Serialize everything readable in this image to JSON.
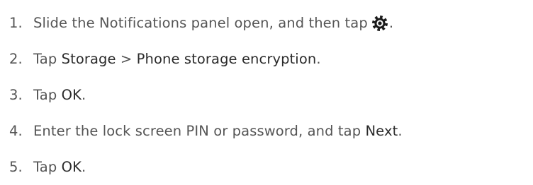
{
  "steps": [
    {
      "number": "1.",
      "parts": [
        {
          "text": "Slide the Notifications panel open, and then tap"
        },
        {
          "icon": "settings-gear-icon"
        },
        {
          "text": "."
        }
      ]
    },
    {
      "number": "2.",
      "parts": [
        {
          "text": "Tap "
        },
        {
          "text": "Storage",
          "emph": true
        },
        {
          "text": " > "
        },
        {
          "text": "Phone storage encryption",
          "emph": true
        },
        {
          "text": "."
        }
      ]
    },
    {
      "number": "3.",
      "parts": [
        {
          "text": "Tap "
        },
        {
          "text": "OK",
          "emph": true
        },
        {
          "text": "."
        }
      ]
    },
    {
      "number": "4.",
      "parts": [
        {
          "text": "Enter the lock screen PIN or password, and tap "
        },
        {
          "text": "Next",
          "emph": true
        },
        {
          "text": "."
        }
      ]
    },
    {
      "number": "5.",
      "parts": [
        {
          "text": "Tap "
        },
        {
          "text": "OK",
          "emph": true
        },
        {
          "text": "."
        }
      ]
    }
  ]
}
